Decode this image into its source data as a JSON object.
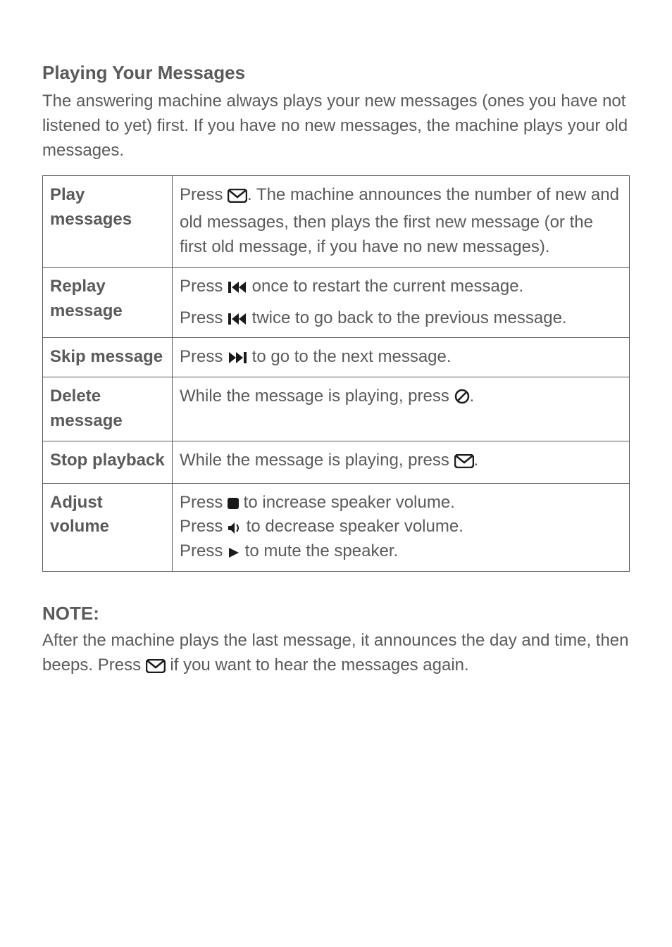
{
  "section_title": "Playing Your Messages",
  "intro_para": "The answering machine always plays your new messages (ones you have not listened to yet) first. If you have no new messages, the machine plays your old messages.",
  "table": {
    "rows": [
      {
        "left": "Play messages",
        "right_prefix": "Press ",
        "right_icon": "env",
        "right_mid": ". The machine announces the number of new and old messages, then plays the first new message (or the first old message, if you have no new messages)."
      },
      {
        "left": "Replay message",
        "right_a_prefix": "Press ",
        "right_a_icon": "prev",
        "right_a_after": " once to restart the current message.",
        "right_b_prefix": "Press ",
        "right_b_icon": "prev",
        "right_b_after": " twice to go back to the previous message."
      },
      {
        "left": "Skip message",
        "right_prefix": "Press ",
        "right_icon": "next",
        "right_after": " to go to the next message."
      },
      {
        "left": "Delete message",
        "right_prefix": "While the message is playing, press ",
        "right_icon": "del",
        "right_after": "."
      },
      {
        "left": "Stop playback",
        "right_prefix": "While the message is playing, press ",
        "right_icon": "env",
        "right_after": "."
      },
      {
        "left": "Adjust volume",
        "right_prefix": "Press ",
        "right_icon1": "stop",
        "right_mid1": " to increase speaker volume.",
        "right_prefix2": "Press ",
        "right_icon2": "vol",
        "right_mid2": " to decrease speaker volume.",
        "right_prefix3": "Press ",
        "right_icon3": "play",
        "right_mid3": " to mute the speaker."
      }
    ]
  },
  "note_title": "NOTE:",
  "note_para_prefix": "After the machine plays the last message, it announces the day and time, then beeps. Press ",
  "note_para_after": " if you want to hear the messages again."
}
